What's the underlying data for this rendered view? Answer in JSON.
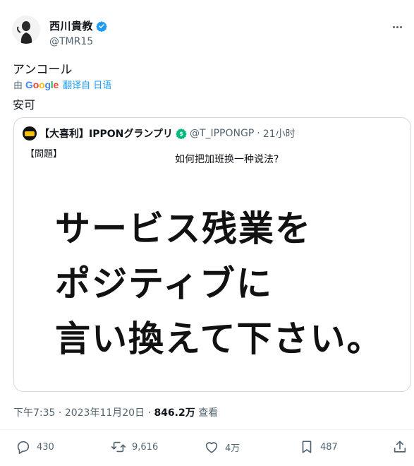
{
  "author": {
    "name": "西川貴教",
    "handle": "@TMR15",
    "verified_color": "#1d9bf0"
  },
  "tweet": {
    "text": "アンコール",
    "translate_prefix": "由",
    "translate_brand": "Google",
    "translate_link": "翻译自 日语",
    "translated_text": "安可"
  },
  "quote": {
    "name": "【大喜利】IPPONグランプリ",
    "handle": "@T_IPPONGP",
    "separator": "·",
    "time": "21小时",
    "label": "【問題】",
    "overlay_text": "如何把加班换一种说法?",
    "body_lines": [
      "サービス残業を",
      "ポジティブに",
      "言い換えて下さい。"
    ],
    "badge_color": "#00ba7c"
  },
  "meta": {
    "time": "下午7:35",
    "separator1": "·",
    "date": "2023年11月20日",
    "separator2": "·",
    "views": "846.2万",
    "views_label": "查看"
  },
  "actions": {
    "replies": "430",
    "retweets": "9,616",
    "likes": "4万",
    "bookmarks": "487"
  },
  "icons": {
    "reply": "reply-icon",
    "retweet": "retweet-icon",
    "like": "heart-icon",
    "bookmark": "bookmark-icon",
    "share": "share-icon",
    "more": "more-icon",
    "verified": "verified-badge-icon"
  }
}
